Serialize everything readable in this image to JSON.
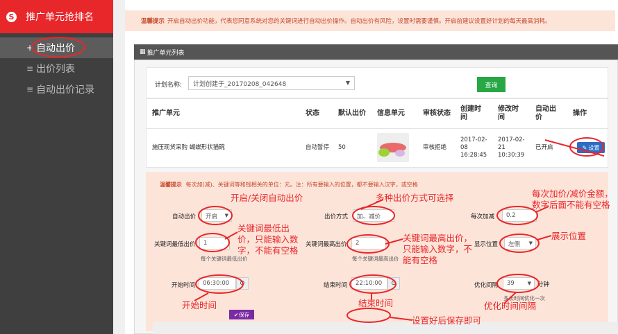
{
  "sidebar": {
    "brand": "推广单元抢排名",
    "brand_icon": "S",
    "items": [
      {
        "label": "自动出价",
        "icon": "plus"
      },
      {
        "label": "出价列表",
        "icon": "list"
      },
      {
        "label": "自动出价记录",
        "icon": "list"
      }
    ]
  },
  "tip": {
    "label": "温馨提示",
    "text": "开启自动出价功能，代表您同意系统对您的关键词进行自动出价操作。自动出价有风险，设置时需要谨慎。开启前建议设置好计划的每天最高消耗。"
  },
  "panel": {
    "title": "推广单元列表"
  },
  "search": {
    "label": "计划名称:",
    "selected": "计划创建于_20170208_042648",
    "button": "查询"
  },
  "table": {
    "headers": [
      "推广单元",
      "状态",
      "默认出价",
      "信息单元",
      "审核状态",
      "创建时间",
      "修改时间",
      "自动出价",
      "操作"
    ],
    "row": {
      "unit": "施压现货采购 蝴蝶形状猫碗",
      "status": "自动暂停",
      "bid": "50",
      "audit": "审核拒绝",
      "created": "2017-02-08 16:28:45",
      "modified": "2017-02-21 10:30:39",
      "auto": "已开启",
      "action": "设置"
    }
  },
  "settings": {
    "tip_label": "温馨提示",
    "tip": "每次加(减)、关键词等和钱相关的单位：元。注：所有要输入的位置，都不要输入汉字，或空格",
    "auto_bid_label": "自动出价",
    "auto_bid_value": "开启",
    "bid_mode_label": "出价方式",
    "bid_mode_value": "加、减价",
    "step_label": "每次加减",
    "step_value": "0.2",
    "min_label": "关键词最低出价",
    "min_value": "1",
    "min_help": "每个关键词最低出价",
    "max_label": "关键词最高出价",
    "max_value": "2",
    "max_help": "每个关键词最高出价",
    "position_label": "显示位置",
    "position_value": "左侧",
    "start_label": "开始时间",
    "start_value": "06:30:00",
    "end_label": "结束时间",
    "end_value": "22:10:00",
    "interval_label": "优化间隔",
    "interval_value": "39",
    "interval_unit": "分钟",
    "interval_help": "多长时间优化一次",
    "save": "保存"
  },
  "annotations": {
    "toggle": "开启/关闭自动出价",
    "modes": "多种出价方式可选择",
    "step": "每次加价/减价金额，数字后面不能有空格",
    "min": "关键词最低出价，只能输入数字，不能有空格",
    "max": "关键词最高出价，只能输入数字，不能有空格",
    "position": "展示位置",
    "start": "开始时间",
    "end": "结束时间",
    "interval": "优化时间间隔",
    "save": "设置好后保存即可"
  }
}
